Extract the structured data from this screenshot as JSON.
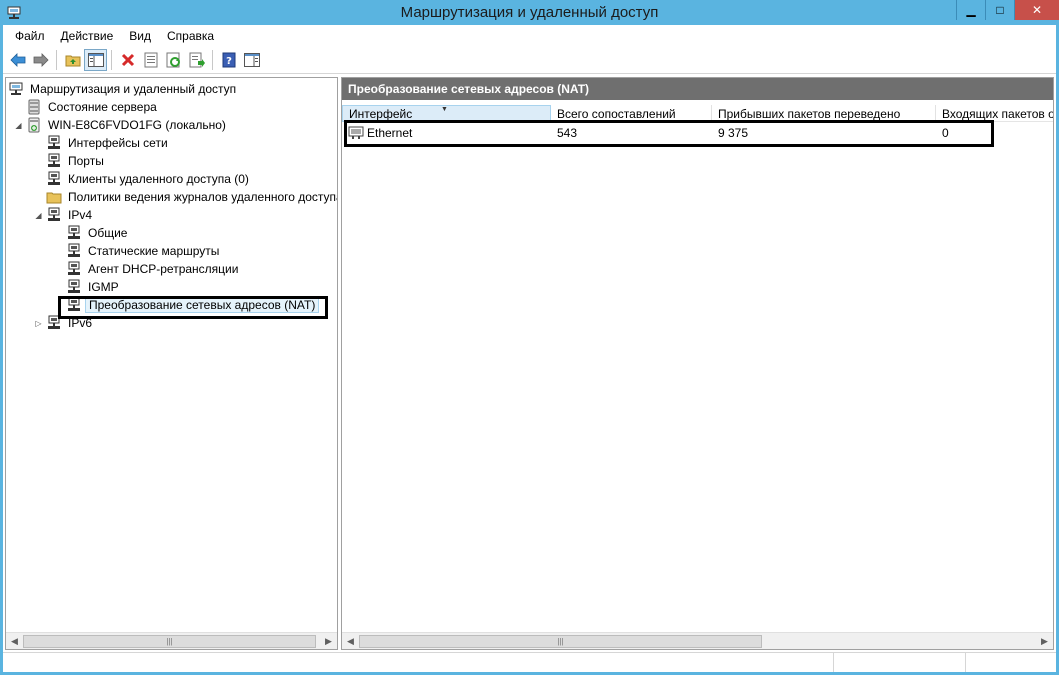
{
  "window": {
    "title": "Маршрутизация и удаленный доступ",
    "minimize_label": "▁",
    "maximize_label": "□",
    "close_label": "✕"
  },
  "menu": {
    "items": [
      {
        "label": "Файл"
      },
      {
        "label": "Действие"
      },
      {
        "label": "Вид"
      },
      {
        "label": "Справка"
      }
    ]
  },
  "toolbar": {
    "icons": [
      "back-arrow-icon",
      "forward-arrow-icon",
      "up-folder-icon",
      "show-hide-tree-icon",
      "delete-icon",
      "properties-icon",
      "refresh-icon",
      "export-list-icon",
      "help-icon",
      "action-pane-icon"
    ]
  },
  "tree": {
    "items": [
      {
        "label": "Маршрутизация и удаленный доступ",
        "level": 0
      },
      {
        "label": "Состояние сервера",
        "level": 1
      },
      {
        "label": "WIN-E8C6FVDO1FG (локально)",
        "level": 1
      },
      {
        "label": "Интерфейсы сети",
        "level": 2
      },
      {
        "label": "Порты",
        "level": 2
      },
      {
        "label": "Клиенты удаленного доступа (0)",
        "level": 2
      },
      {
        "label": "Политики ведения журналов удаленного доступа",
        "level": 2
      },
      {
        "label": "IPv4",
        "level": 2
      },
      {
        "label": "Общие",
        "level": 3
      },
      {
        "label": "Статические маршруты",
        "level": 3
      },
      {
        "label": "Агент DHCP-ретрансляции",
        "level": 3
      },
      {
        "label": "IGMP",
        "level": 3
      },
      {
        "label": "Преобразование сетевых адресов (NAT)",
        "level": 3
      },
      {
        "label": "IPv6",
        "level": 2
      }
    ]
  },
  "details": {
    "header": "Преобразование сетевых адресов (NAT)",
    "columns": [
      {
        "label": "Интерфейс"
      },
      {
        "label": "Всего сопоставлений"
      },
      {
        "label": "Прибывших пакетов переведено"
      },
      {
        "label": "Входящих пакетов о"
      }
    ],
    "rows": [
      {
        "interface": "Ethernet",
        "total_mappings": "543",
        "inbound_translated": "9 375",
        "inbound_packets": "0"
      }
    ]
  },
  "scrollbar": {
    "left_arrow": "◀",
    "right_arrow": "▶",
    "grip": "|||"
  },
  "colors": {
    "title_bar": "#5ab4e0",
    "close_button": "#c7504a",
    "detail_header": "#6f6f6f",
    "highlight_box": "#000000"
  }
}
